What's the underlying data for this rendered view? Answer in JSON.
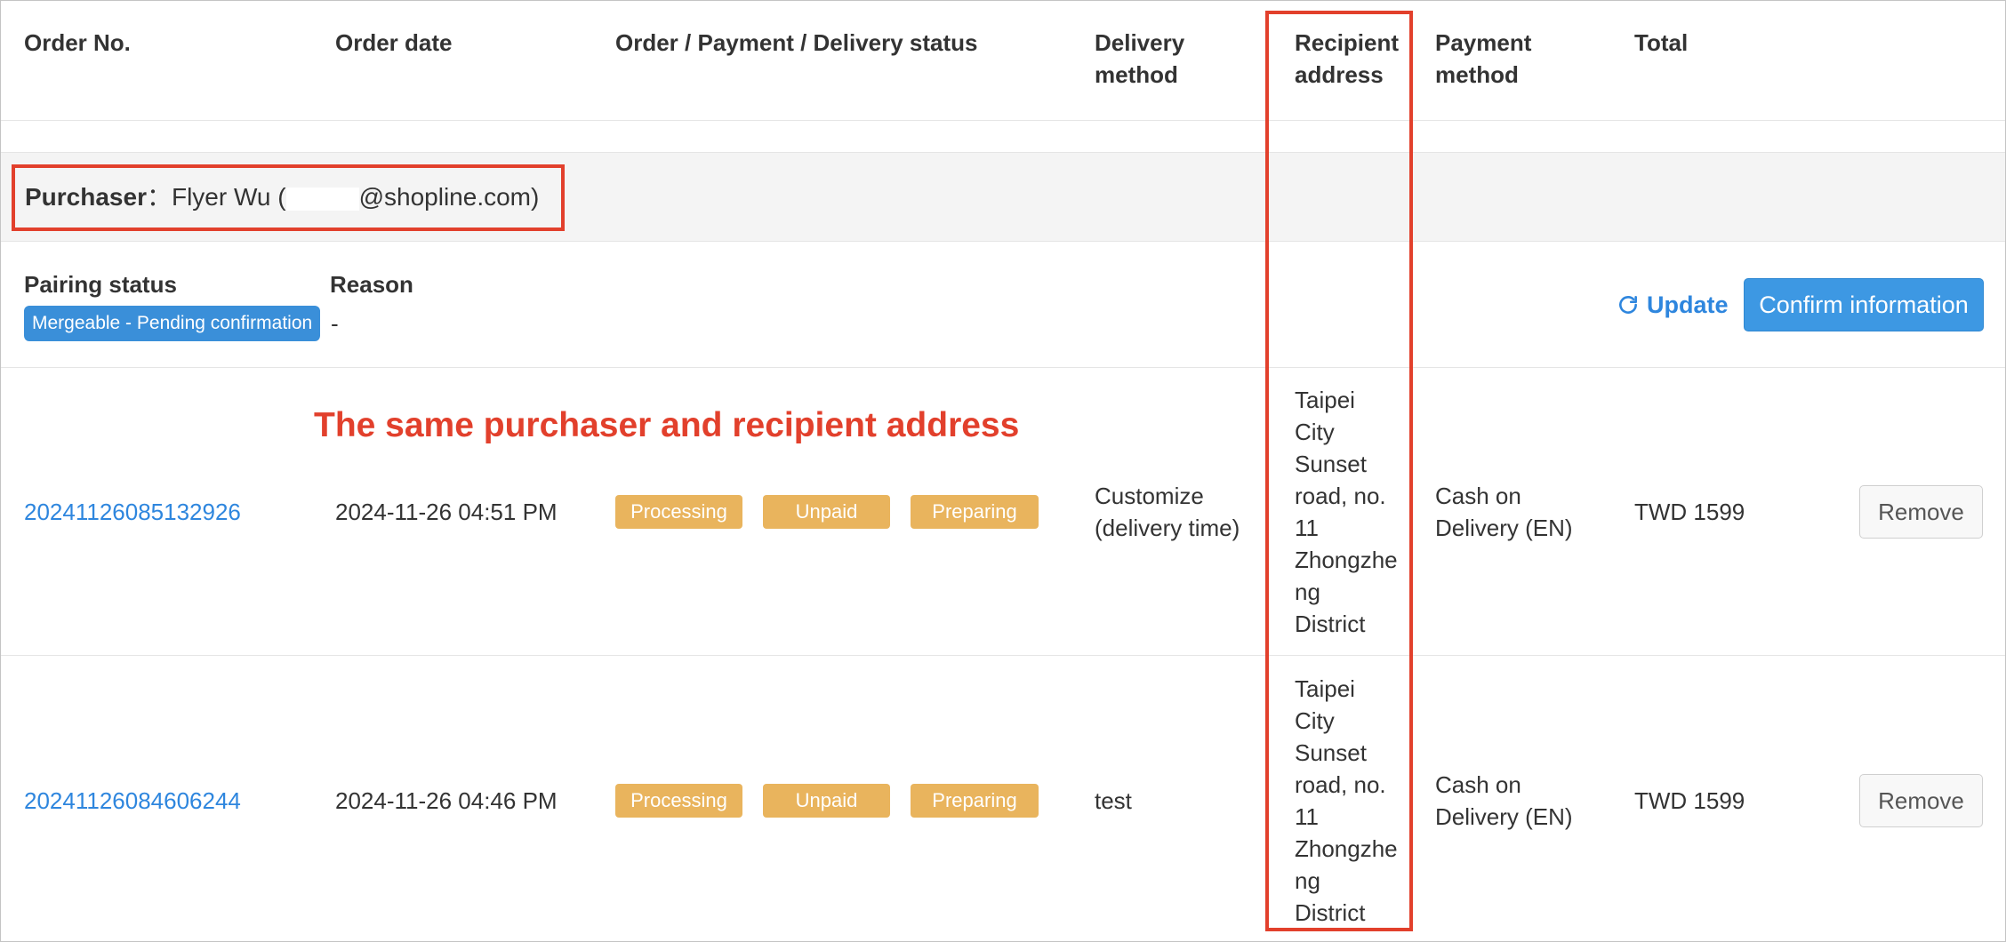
{
  "columns": {
    "order_no": "Order No.",
    "order_date": "Order date",
    "status": "Order / Payment / Delivery status",
    "delivery_method_line1": "Delivery",
    "delivery_method_line2": "method",
    "recipient_address_line1": "Recipient",
    "recipient_address_line2": "address",
    "payment_method_line1": "Payment",
    "payment_method_line2": "method",
    "total": "Total"
  },
  "purchaser": {
    "label": "Purchaser",
    "separator": "：",
    "name_prefix": "Flyer Wu (",
    "email_suffix": "@shopline.com)"
  },
  "pairing": {
    "status_label": "Pairing status",
    "reason_label": "Reason",
    "status_badge": "Mergeable - Pending confirmation",
    "reason_value": "-",
    "update_label": "Update",
    "confirm_label": "Confirm information"
  },
  "annotation": "The same purchaser and recipient address",
  "orders": [
    {
      "order_no": "20241126085132926",
      "date": "2024-11-26 04:51 PM",
      "statuses": [
        "Processing",
        "Unpaid",
        "Preparing"
      ],
      "delivery_lines": [
        "Customize",
        "(delivery time)"
      ],
      "address_lines": [
        "Taipei",
        "City",
        "Sunset",
        "road, no.",
        "11",
        "Zhongzhe",
        "ng",
        "District"
      ],
      "payment_lines": [
        "Cash on",
        "Delivery (EN)"
      ],
      "total": "TWD 1599",
      "remove_label": "Remove"
    },
    {
      "order_no": "20241126084606244",
      "date": "2024-11-26 04:46 PM",
      "statuses": [
        "Processing",
        "Unpaid",
        "Preparing"
      ],
      "delivery_lines": [
        "test"
      ],
      "address_lines": [
        "Taipei",
        "City",
        "Sunset",
        "road, no.",
        "11",
        "Zhongzhe",
        "ng",
        "District"
      ],
      "payment_lines": [
        "Cash on",
        "Delivery (EN)"
      ],
      "total": "TWD 1599",
      "remove_label": "Remove"
    }
  ],
  "colors": {
    "highlight_red": "#e2402c",
    "badge_orange": "#e9b45d",
    "primary_blue": "#3d98e3",
    "link_blue": "#2e86de"
  },
  "icons": {
    "update": "refresh-icon"
  }
}
